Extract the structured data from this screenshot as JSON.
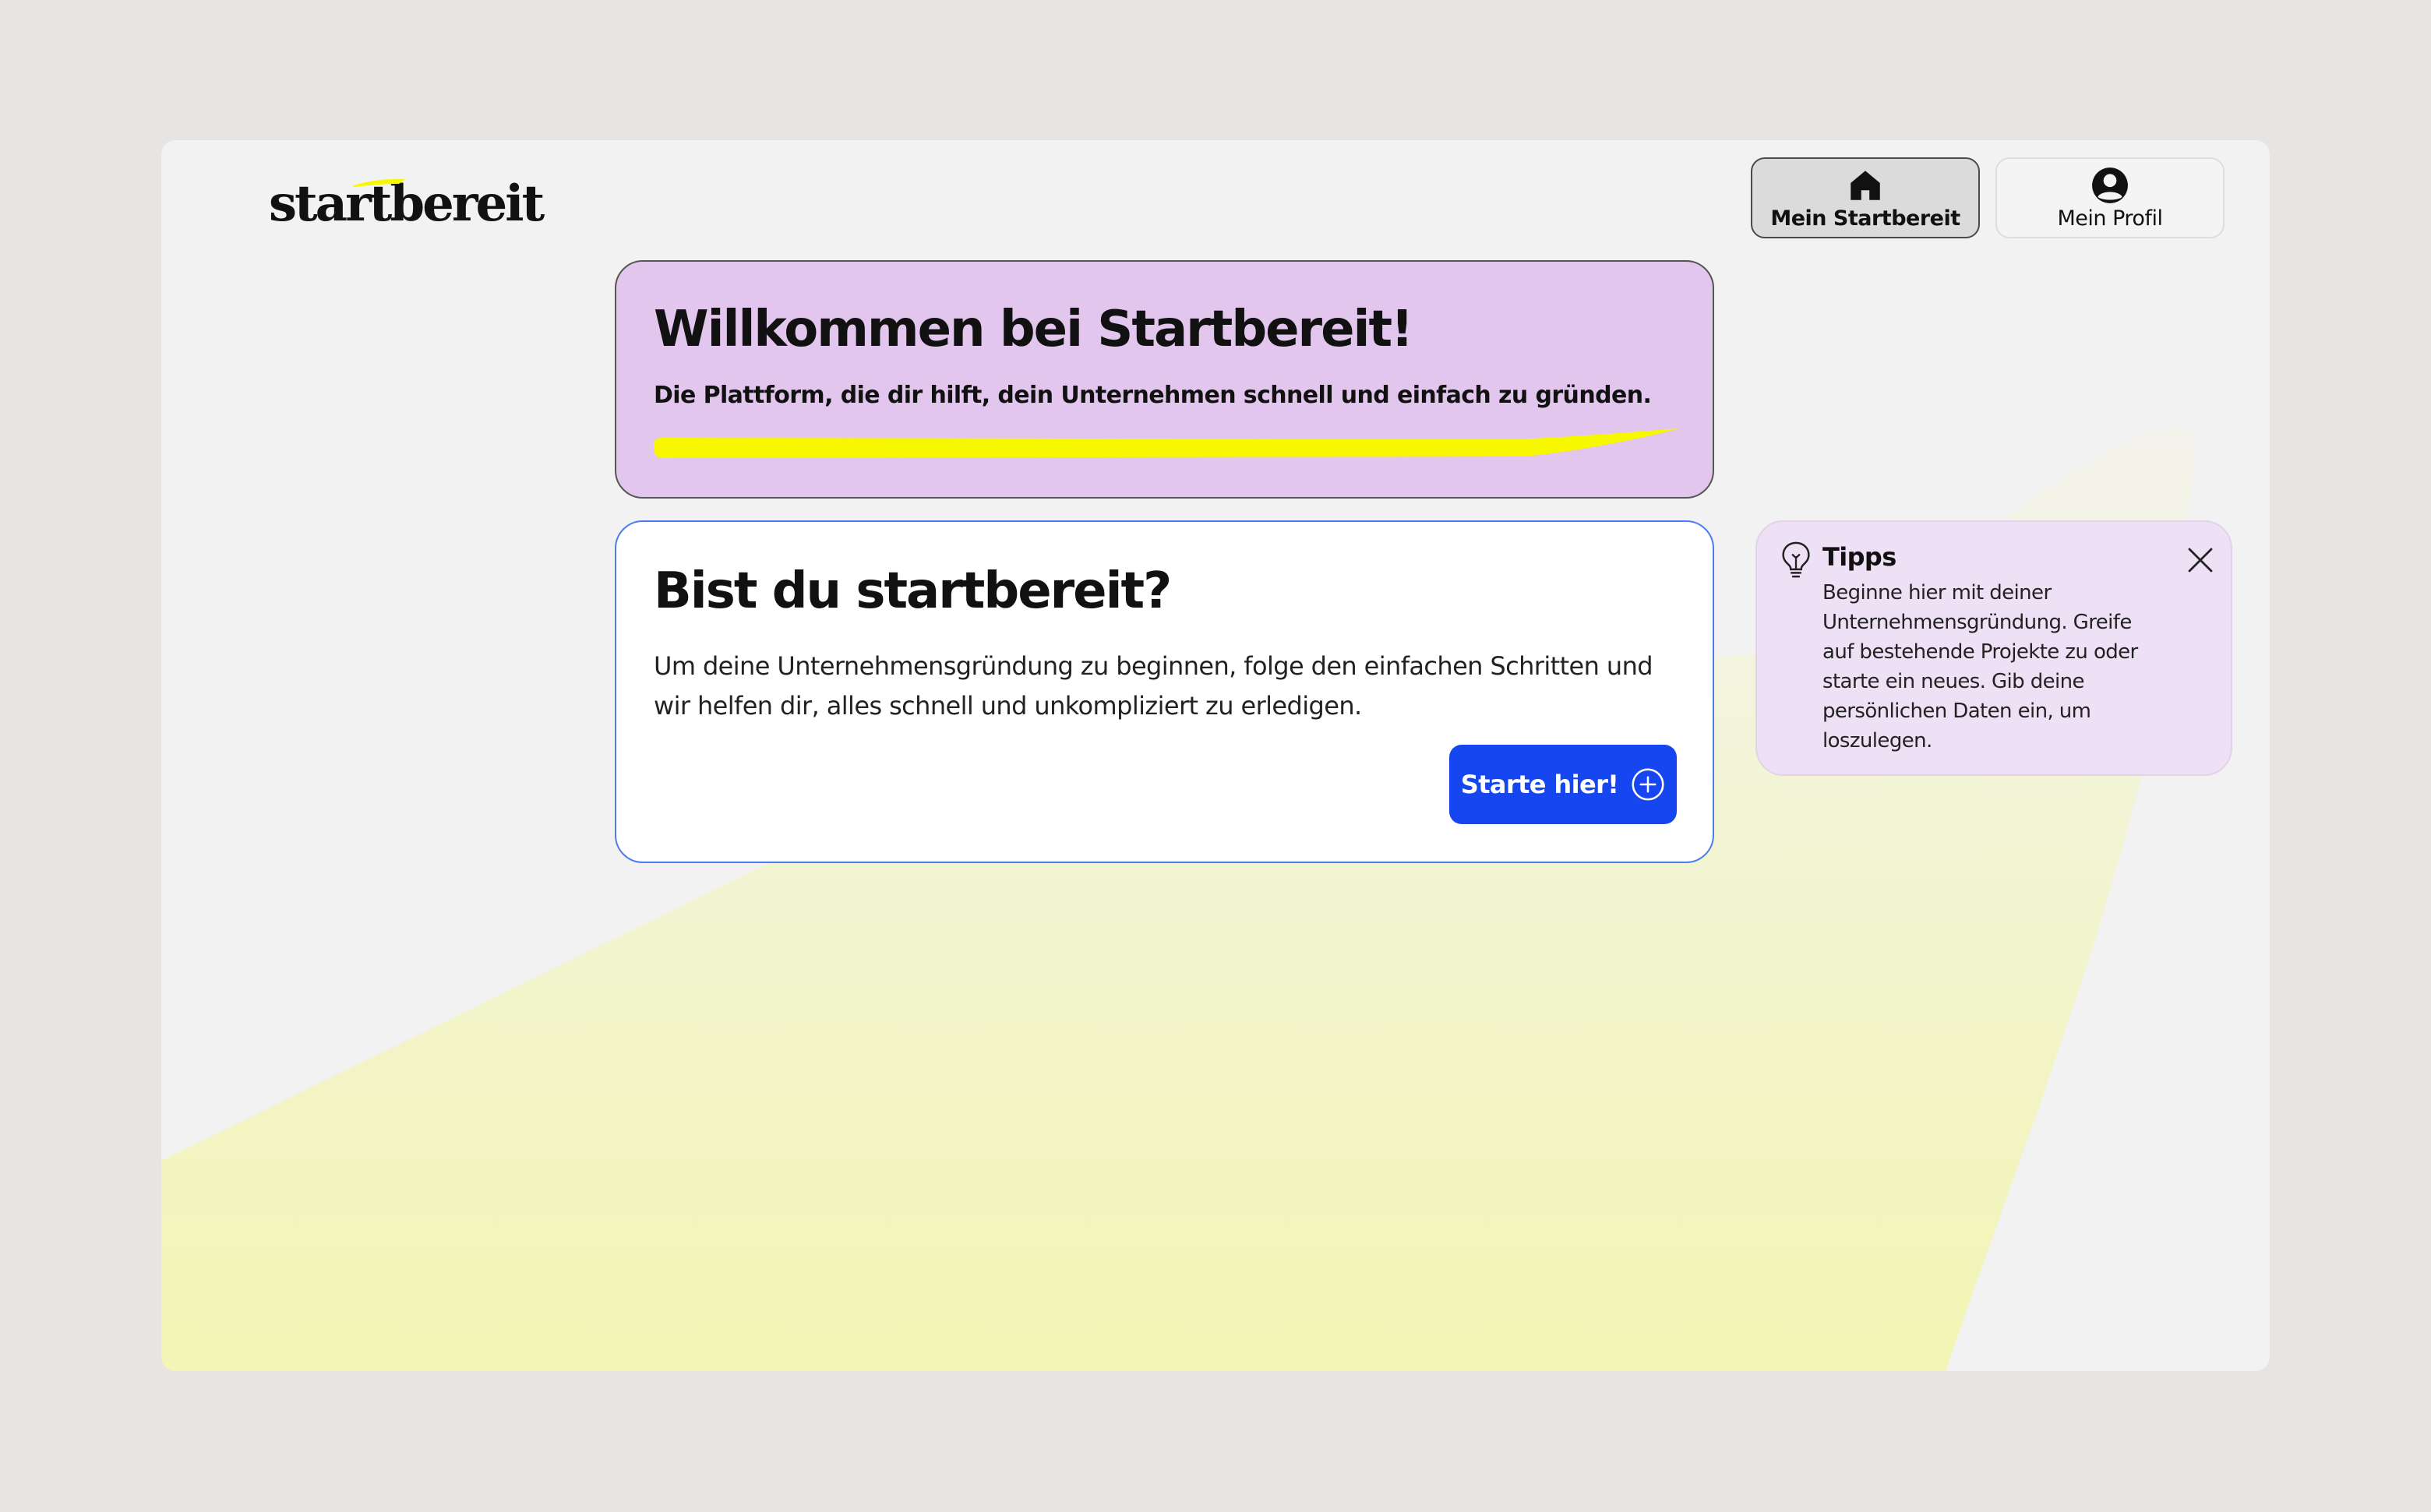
{
  "app": {
    "logo_text": "startbereit"
  },
  "header": {
    "nav": [
      {
        "label": "Mein Startbereit",
        "icon": "home-icon",
        "active": true
      },
      {
        "label": "Mein Profil",
        "icon": "user-circle-icon",
        "active": false
      }
    ]
  },
  "welcome": {
    "title": "Willkommen bei Startbereit!",
    "subtitle": "Die Plattform, die dir hilft, dein Unternehmen schnell und einfach zu gründen."
  },
  "start": {
    "title": "Bist du startbereit?",
    "text": "Um deine Unternehmensgründung zu beginnen, folge den einfachen Schritten und wir helfen dir, alles schnell und unkompliziert zu erledigen.",
    "button_label": "Starte hier!",
    "button_icon": "plus-circle-icon"
  },
  "tips": {
    "icon": "lightbulb-icon",
    "title": "Tipps",
    "text": "Beginne hier mit deiner Unternehmensgründung. Greife auf bestehende Projekte zu oder starte ein neues. Gib deine persönlichen Daten ein, um loszulegen.",
    "close_icon": "close-icon"
  },
  "colors": {
    "page_background": "#e6e5e3",
    "frame_background": "#f2f2f2",
    "welcome_card": "#e2c6ed",
    "tips_card": "#efe1f5",
    "accent_blue": "#1546f0",
    "accent_yellow": "#f7f700",
    "glow_yellow": "#f2f5b9"
  }
}
